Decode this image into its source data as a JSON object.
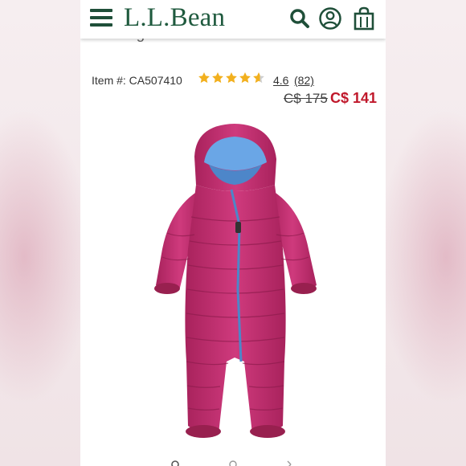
{
  "header": {
    "logo_text": "L.L.Bean",
    "icons": [
      "menu-icon",
      "search-icon",
      "account-icon",
      "bag-icon"
    ]
  },
  "product": {
    "title_partial": "Bunting",
    "item_label": "Item #: CA507410",
    "rating": "4.6",
    "rating_fraction": 0.92,
    "reviews": "(82)",
    "price_original": "C$ 175",
    "price_sale": "C$ 141",
    "image": "pink-puffer-bunting-snowsuit"
  },
  "colors": {
    "brand_green": "#1f5a3e",
    "sale_red": "#c0182b",
    "star_gold": "#f2b01e",
    "product_pink": "#c2306f",
    "lining_blue": "#6aa6e6"
  }
}
